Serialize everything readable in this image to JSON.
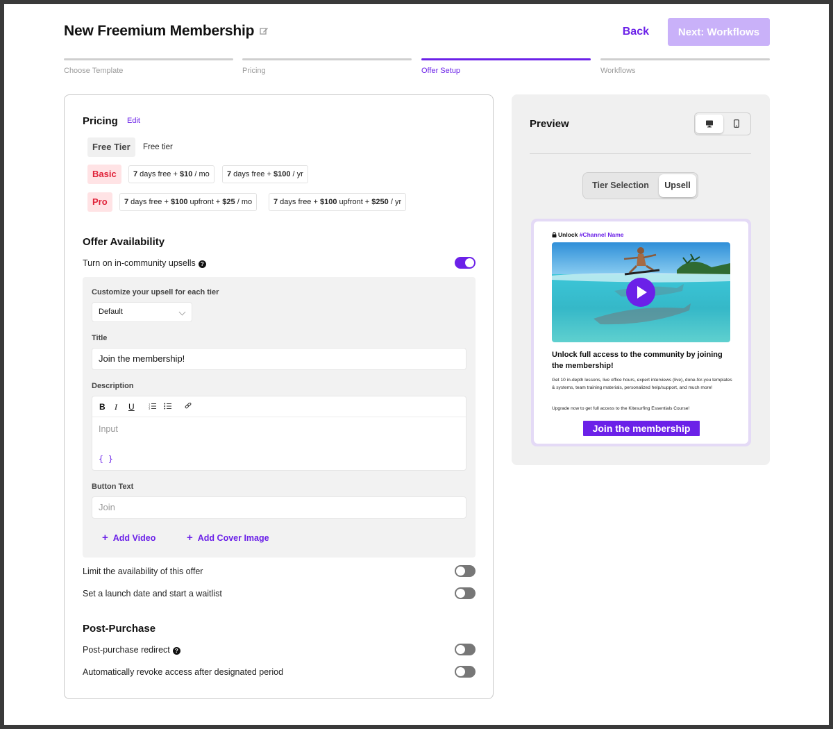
{
  "header": {
    "title": "New Freemium Membership",
    "back_label": "Back",
    "next_label": "Next: Workflows"
  },
  "steps": [
    {
      "label": "Choose Template",
      "active": false
    },
    {
      "label": "Pricing",
      "active": false
    },
    {
      "label": "Offer Setup",
      "active": true
    },
    {
      "label": "Workflows",
      "active": false
    }
  ],
  "pricing": {
    "title": "Pricing",
    "edit_label": "Edit",
    "free": {
      "tag": "Free Tier",
      "text": "Free tier"
    },
    "basic": {
      "tag": "Basic",
      "options": [
        {
          "p1": "7",
          "t1": " days free + ",
          "p2": "$10",
          "t2": " / mo"
        },
        {
          "p1": "7",
          "t1": " days free + ",
          "p2": "$100",
          "t2": " / yr"
        }
      ]
    },
    "pro": {
      "tag": "Pro",
      "options": [
        {
          "p1": "7",
          "t1": " days free + ",
          "p2": "$100",
          "t2": " upfront + ",
          "p3": "$25",
          "t3": " / mo"
        },
        {
          "p1": "7",
          "t1": " days free + ",
          "p2": "$100",
          "t2": " upfront + ",
          "p3": "$250",
          "t3": " / yr"
        }
      ]
    }
  },
  "availability": {
    "title": "Offer Availability",
    "upsell_toggle_label": "Turn on in-community upsells",
    "upsell_toggle_on": true,
    "customize_label": "Customize your upsell for each tier",
    "tier_select_value": "Default",
    "title_label": "Title",
    "title_value": "Join the membership!",
    "description_label": "Description",
    "description_placeholder": "Input",
    "braces": "{ }",
    "toolbar": {
      "bold": "B",
      "italic": "I",
      "underline": "U"
    },
    "button_text_label": "Button Text",
    "button_text_placeholder": "Join",
    "add_video": "Add Video",
    "add_cover": "Add Cover Image",
    "limit_label": "Limit the availability of this offer",
    "launch_label": "Set a launch date and start a waitlist"
  },
  "post_purchase": {
    "title": "Post-Purchase",
    "redirect_label": "Post-purchase redirect",
    "revoke_label": "Automatically revoke access after designated period"
  },
  "preview": {
    "title": "Preview",
    "tabs": [
      "Tier Selection",
      "Upsell"
    ],
    "active_tab": "Upsell",
    "unlock_prefix": "Unlock ",
    "channel_name": "#Channel Name",
    "heading": "Unlock full access to the community by joining the membership!",
    "body": "Get 10 in-depth lessons, live office hours, expert interviews (live), done-for-you templates & systems, team training materials, personalized help/support, and much more!",
    "body2": "Upgrade now to get full access to the Kitesurfing Essentials Course!",
    "cta": "Join the membership"
  },
  "colors": {
    "accent": "#6b21e8",
    "next_disabled": "#c9b1f9",
    "tier_red": "#e0233a",
    "tier_red_bg": "#ffe3e5"
  }
}
